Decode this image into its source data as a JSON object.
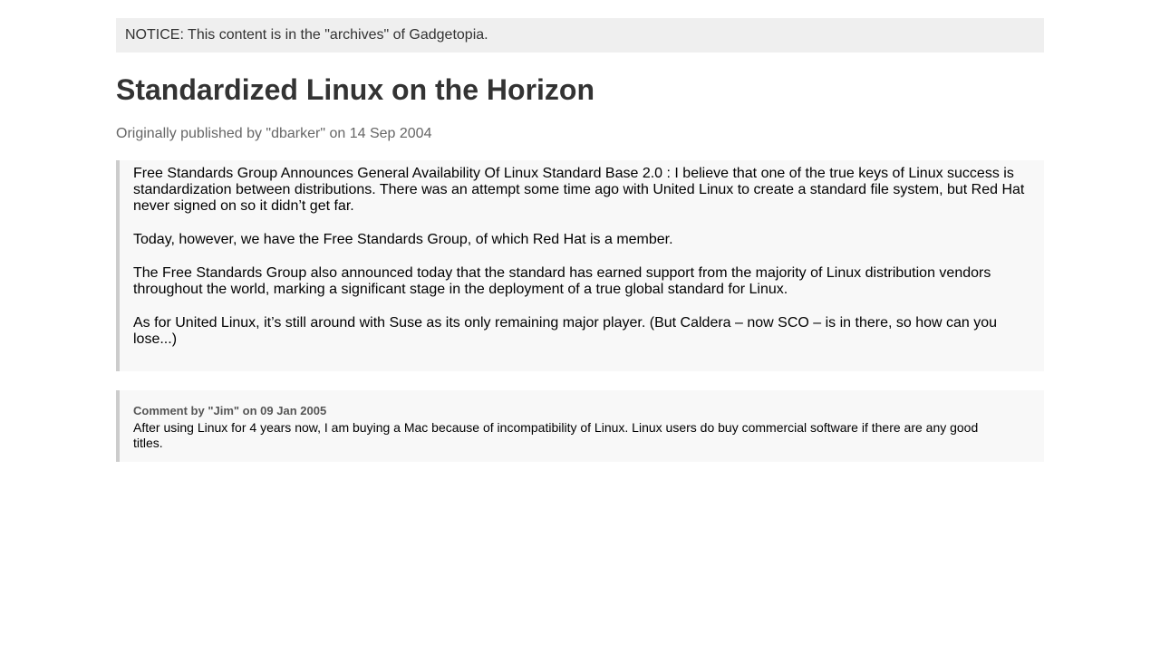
{
  "notice": {
    "text": "NOTICE: This content is in the \"archives\" of Gadgetopia."
  },
  "article": {
    "title": "Standardized Linux on the Horizon",
    "byline": "Originally published by \"dbarker\" on 14 Sep 2004",
    "paragraphs": [
      "Free Standards Group Announces General Availability Of Linux Standard Base 2.0 : I believe that one of the true keys of Linux success is standardization between distributions. There was an attempt some time ago with United Linux to create a standard file system, but Red Hat never signed on so it didn’t get far.",
      "Today, however, we have the Free Standards Group, of which Red Hat is a member.",
      "The Free Standards Group also announced today that the standard has earned support from the majority of Linux distribution vendors throughout the world, marking a significant stage in the deployment of a true global standard for Linux.",
      "As for United Linux, it’s still around with Suse as its only remaining major player. (But Caldera – now SCO – is in there, so how can you lose...)"
    ]
  },
  "comments": [
    {
      "header": "Comment by \"Jim\" on 09 Jan 2005",
      "body": "After using Linux for 4 years now, I am buying a Mac because of incompatibility of Linux. Linux users do buy commercial software if there are any good titles."
    }
  ]
}
